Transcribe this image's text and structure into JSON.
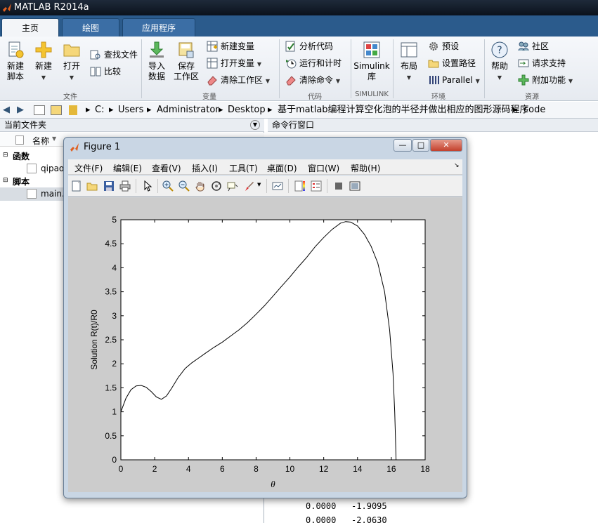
{
  "app": {
    "title": "MATLAB R2014a"
  },
  "tabs": [
    {
      "label": "主页",
      "active": true
    },
    {
      "label": "绘图",
      "active": false
    },
    {
      "label": "应用程序",
      "active": false
    }
  ],
  "ribbon": {
    "file": {
      "label": "文件",
      "new_script": "新建\n脚本",
      "new": "新建",
      "open": "打开",
      "find_files": "查找文件",
      "compare": "比较"
    },
    "variable": {
      "label": "变量",
      "import_data": "导入\n数据",
      "save_workspace": "保存\n工作区",
      "new_variable": "新建变量",
      "open_variable": "打开变量",
      "clear_workspace": "清除工作区"
    },
    "code": {
      "label": "代码",
      "analyze_code": "分析代码",
      "run_and_time": "运行和计时",
      "clear_commands": "清除命令"
    },
    "simulink": {
      "label": "SIMULINK",
      "simulink_library": "Simulink\n库"
    },
    "environment": {
      "label": "环境",
      "layout": "布局",
      "preferences": "预设",
      "set_path": "设置路径",
      "parallel": "Parallel"
    },
    "resources": {
      "label": "资源",
      "help": "帮助",
      "community": "社区",
      "request_support": "请求支持",
      "add_ons": "附加功能"
    }
  },
  "path": {
    "crumbs": [
      "C:",
      "Users",
      "Administrator",
      "Desktop",
      "基于matlab编程计算空化泡的半径并做出相应的图形源码程序",
      "code"
    ]
  },
  "current_folder": {
    "title": "当前文件夹",
    "column_name": "名称",
    "groups": [
      {
        "label": "函数",
        "files": [
          "qipao"
        ]
      },
      {
        "label": "脚本",
        "files": [
          "main."
        ]
      }
    ]
  },
  "command_window": {
    "title": "命令行窗口",
    "lines": [
      {
        "a": "0.0000",
        "b": "-1.9095"
      },
      {
        "a": "0.0000",
        "b": "-2.0630"
      }
    ]
  },
  "figure": {
    "title": "Figure 1",
    "menus": [
      "文件(F)",
      "编辑(E)",
      "查看(V)",
      "插入(I)",
      "工具(T)",
      "桌面(D)",
      "窗口(W)",
      "帮助(H)"
    ],
    "window_buttons": {
      "minimize": "—",
      "maximize": "□",
      "close": "✕"
    }
  },
  "chart_data": {
    "type": "line",
    "title": "",
    "xlabel": "θ",
    "ylabel": "Solution R(t)/R0",
    "xlim": [
      0,
      18
    ],
    "ylim": [
      0,
      5
    ],
    "xticks": [
      0,
      2,
      4,
      6,
      8,
      10,
      12,
      14,
      16,
      18
    ],
    "yticks": [
      0,
      0.5,
      1,
      1.5,
      2,
      2.5,
      3,
      3.5,
      4,
      4.5,
      5
    ],
    "grid": false,
    "series": [
      {
        "name": "",
        "color": "#000000",
        "x": [
          0,
          0.3,
          0.6,
          0.9,
          1.2,
          1.5,
          1.8,
          2.1,
          2.4,
          2.7,
          3.0,
          3.4,
          3.8,
          4.2,
          4.6,
          5.0,
          5.5,
          6.0,
          6.5,
          7.0,
          7.5,
          8.0,
          8.5,
          9.0,
          9.5,
          10.0,
          10.5,
          11.0,
          11.5,
          12.0,
          12.5,
          13.0,
          13.3,
          13.6,
          14.0,
          14.4,
          14.8,
          15.2,
          15.6,
          15.9,
          16.1,
          16.2,
          16.25,
          16.28
        ],
        "y": [
          1.0,
          1.28,
          1.46,
          1.54,
          1.55,
          1.51,
          1.42,
          1.31,
          1.26,
          1.33,
          1.49,
          1.72,
          1.9,
          2.02,
          2.12,
          2.22,
          2.34,
          2.45,
          2.58,
          2.71,
          2.86,
          3.03,
          3.21,
          3.41,
          3.61,
          3.81,
          4.02,
          4.22,
          4.44,
          4.63,
          4.8,
          4.93,
          4.96,
          4.95,
          4.87,
          4.7,
          4.45,
          4.1,
          3.5,
          2.7,
          1.8,
          1.0,
          0.4,
          0.0
        ]
      }
    ]
  }
}
